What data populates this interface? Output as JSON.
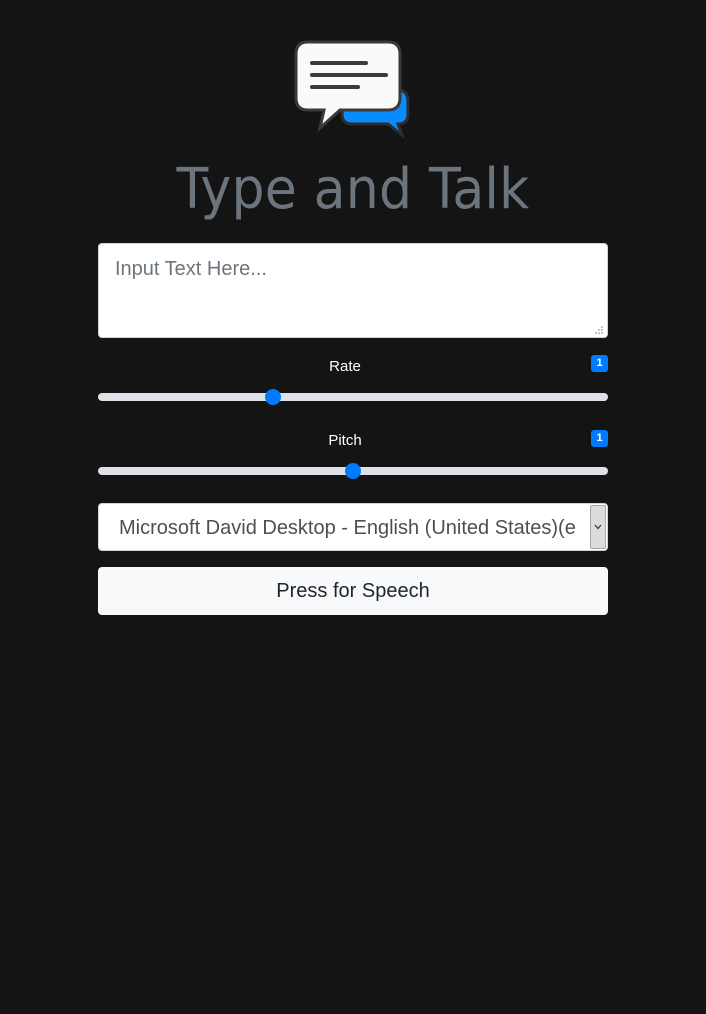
{
  "app": {
    "title": "Type and Talk",
    "logo_icon": "speech-bubbles-icon"
  },
  "text_input": {
    "placeholder": "Input Text Here...",
    "value": ""
  },
  "rate": {
    "label": "Rate",
    "value_display": "1",
    "value": 1,
    "min": 0.5,
    "max": 2
  },
  "pitch": {
    "label": "Pitch",
    "value_display": "1",
    "value": 1,
    "min": 0,
    "max": 2
  },
  "voice_select": {
    "selected": "Microsoft David Desktop - English (United States)(en-US)"
  },
  "speak_button": {
    "label": "Press for Speech"
  },
  "colors": {
    "background": "#141414",
    "accent": "#007bff",
    "title": "#6c757d"
  }
}
